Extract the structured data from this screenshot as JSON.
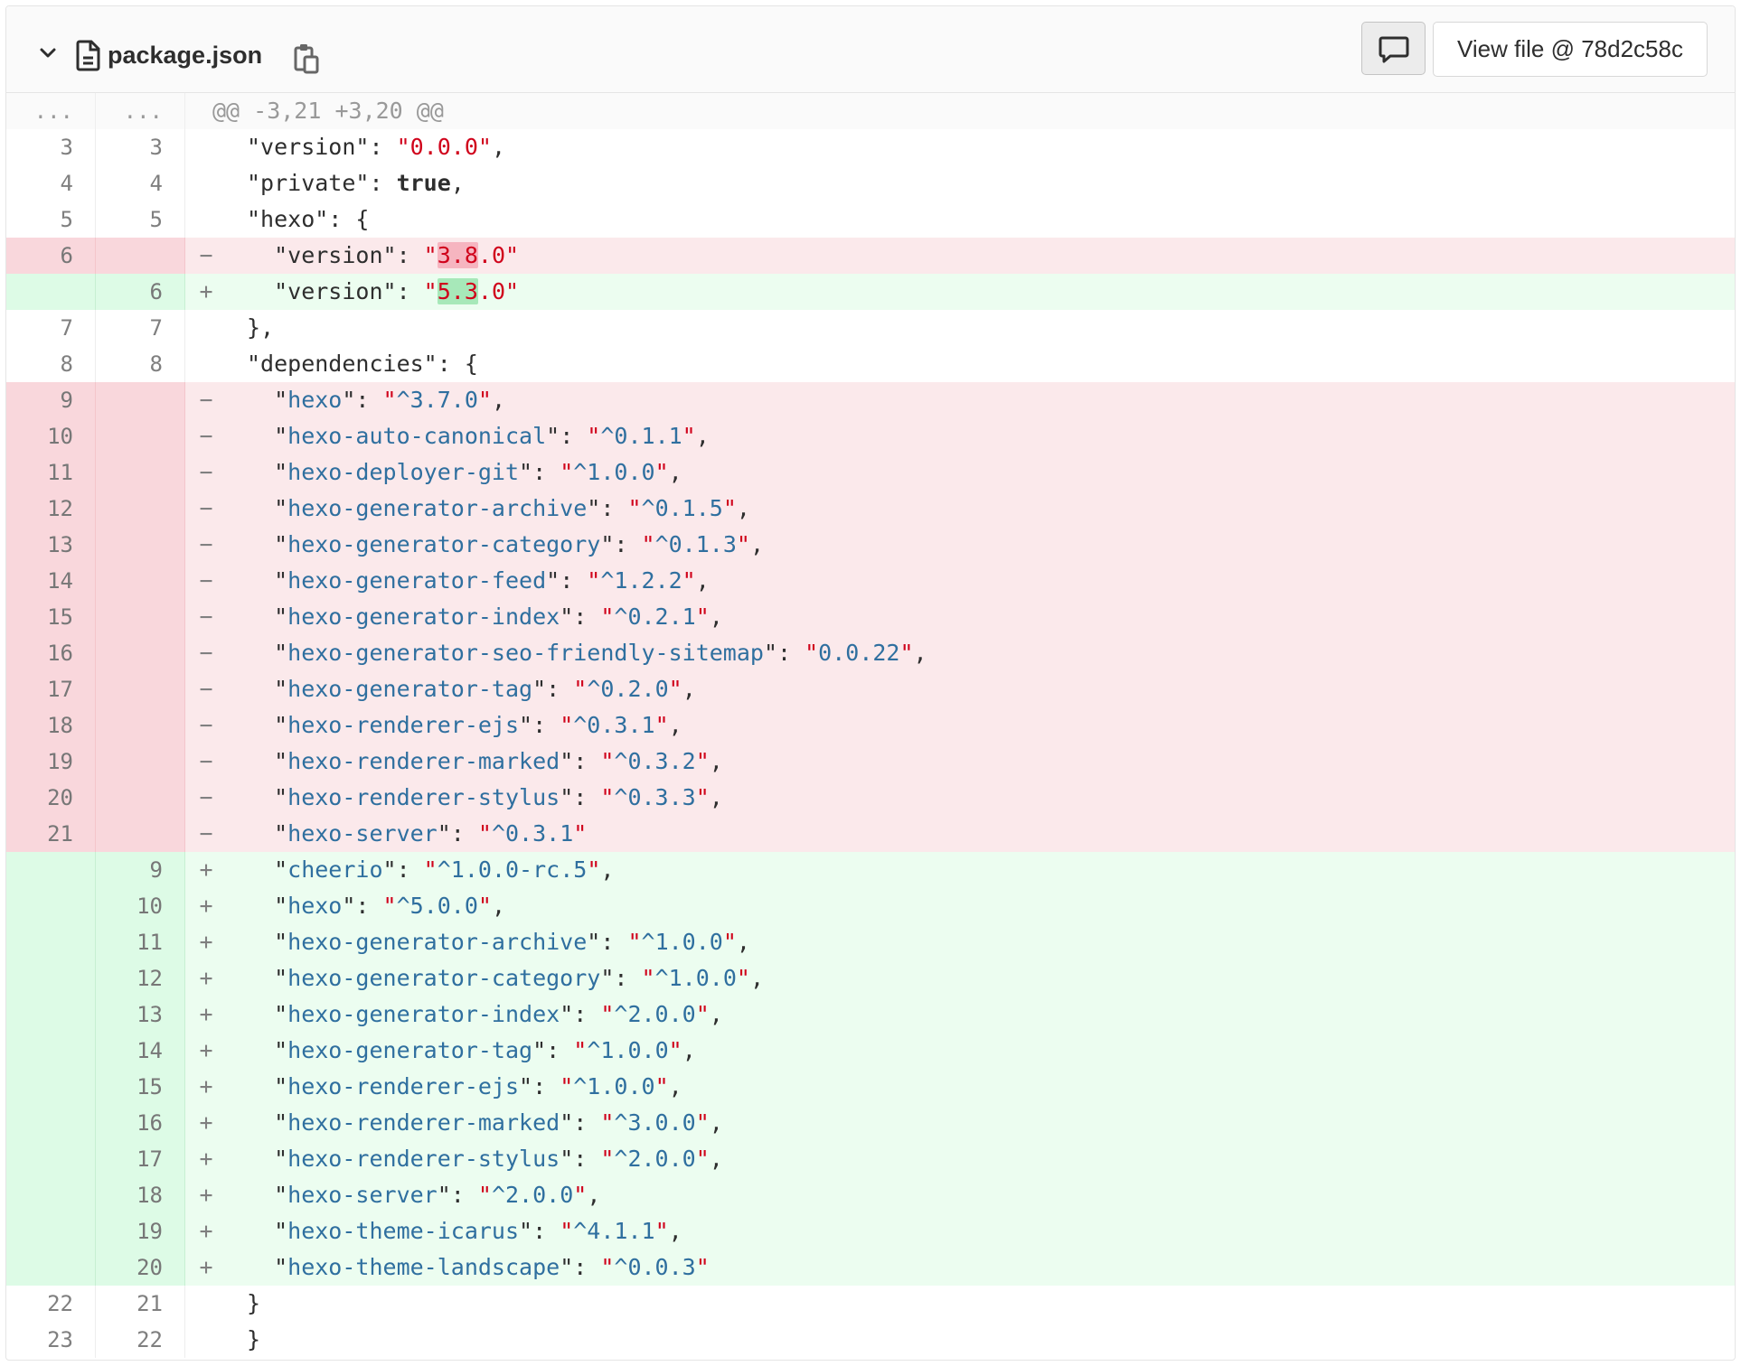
{
  "file": {
    "name": "package.json",
    "view_file_label": "View file @ 78d2c58c"
  },
  "icons": {
    "chevron": "chevron-down-icon",
    "file": "file-icon",
    "copy": "clipboard-icon",
    "comment": "comment-icon"
  },
  "colors": {
    "deleted_bg": "#fbe9eb",
    "added_bg": "#ecfdf0",
    "string": "#d0021b",
    "key": "#2f6f9f"
  },
  "diff": [
    {
      "type": "match",
      "old": "...",
      "new": "...",
      "sign": "",
      "seg": [
        {
          "t": "@@ -3,21 +3,20 @@",
          "c": ""
        }
      ]
    },
    {
      "type": "ctx",
      "old": "3",
      "new": "3",
      "sign": "",
      "seg": [
        {
          "t": "\"version\": ",
          "c": "punc"
        },
        {
          "t": "\"0.0.0\"",
          "c": "str"
        },
        {
          "t": ",",
          "c": "punc"
        }
      ]
    },
    {
      "type": "ctx",
      "old": "4",
      "new": "4",
      "sign": "",
      "seg": [
        {
          "t": "\"private\": ",
          "c": "punc"
        },
        {
          "t": "true",
          "c": "kw"
        },
        {
          "t": ",",
          "c": "punc"
        }
      ]
    },
    {
      "type": "ctx",
      "old": "5",
      "new": "5",
      "sign": "",
      "seg": [
        {
          "t": "\"hexo\": {",
          "c": "punc"
        }
      ]
    },
    {
      "type": "del",
      "old": "6",
      "new": "",
      "sign": "−",
      "seg": [
        {
          "t": "  \"version\": ",
          "c": "punc"
        },
        {
          "t": "\"",
          "c": "str"
        },
        {
          "t": "3.8",
          "c": "str hl-del"
        },
        {
          "t": ".0\"",
          "c": "str"
        }
      ]
    },
    {
      "type": "add",
      "old": "",
      "new": "6",
      "sign": "+",
      "seg": [
        {
          "t": "  \"version\": ",
          "c": "punc"
        },
        {
          "t": "\"",
          "c": "str"
        },
        {
          "t": "5.3",
          "c": "str hl-add"
        },
        {
          "t": ".0\"",
          "c": "str"
        }
      ]
    },
    {
      "type": "ctx",
      "old": "7",
      "new": "7",
      "sign": "",
      "seg": [
        {
          "t": "},",
          "c": "punc"
        }
      ]
    },
    {
      "type": "ctx",
      "old": "8",
      "new": "8",
      "sign": "",
      "seg": [
        {
          "t": "\"dependencies\": {",
          "c": "punc"
        }
      ]
    },
    {
      "type": "del",
      "old": "9",
      "new": "",
      "sign": "−",
      "seg": [
        {
          "t": "  \"",
          "c": "punc"
        },
        {
          "t": "hexo",
          "c": "key"
        },
        {
          "t": "\": ",
          "c": "punc"
        },
        {
          "t": "\"",
          "c": "str"
        },
        {
          "t": "^3.7.0",
          "c": "num"
        },
        {
          "t": "\"",
          "c": "str"
        },
        {
          "t": ",",
          "c": "punc"
        }
      ]
    },
    {
      "type": "del",
      "old": "10",
      "new": "",
      "sign": "−",
      "seg": [
        {
          "t": "  \"",
          "c": "punc"
        },
        {
          "t": "hexo-auto-canonical",
          "c": "key"
        },
        {
          "t": "\": ",
          "c": "punc"
        },
        {
          "t": "\"",
          "c": "str"
        },
        {
          "t": "^0.1.1",
          "c": "num"
        },
        {
          "t": "\"",
          "c": "str"
        },
        {
          "t": ",",
          "c": "punc"
        }
      ]
    },
    {
      "type": "del",
      "old": "11",
      "new": "",
      "sign": "−",
      "seg": [
        {
          "t": "  \"",
          "c": "punc"
        },
        {
          "t": "hexo-deployer-git",
          "c": "key"
        },
        {
          "t": "\": ",
          "c": "punc"
        },
        {
          "t": "\"",
          "c": "str"
        },
        {
          "t": "^1.0.0",
          "c": "num"
        },
        {
          "t": "\"",
          "c": "str"
        },
        {
          "t": ",",
          "c": "punc"
        }
      ]
    },
    {
      "type": "del",
      "old": "12",
      "new": "",
      "sign": "−",
      "seg": [
        {
          "t": "  \"",
          "c": "punc"
        },
        {
          "t": "hexo-generator-archive",
          "c": "key"
        },
        {
          "t": "\": ",
          "c": "punc"
        },
        {
          "t": "\"",
          "c": "str"
        },
        {
          "t": "^0.1.5",
          "c": "num"
        },
        {
          "t": "\"",
          "c": "str"
        },
        {
          "t": ",",
          "c": "punc"
        }
      ]
    },
    {
      "type": "del",
      "old": "13",
      "new": "",
      "sign": "−",
      "seg": [
        {
          "t": "  \"",
          "c": "punc"
        },
        {
          "t": "hexo-generator-category",
          "c": "key"
        },
        {
          "t": "\": ",
          "c": "punc"
        },
        {
          "t": "\"",
          "c": "str"
        },
        {
          "t": "^0.1.3",
          "c": "num"
        },
        {
          "t": "\"",
          "c": "str"
        },
        {
          "t": ",",
          "c": "punc"
        }
      ]
    },
    {
      "type": "del",
      "old": "14",
      "new": "",
      "sign": "−",
      "seg": [
        {
          "t": "  \"",
          "c": "punc"
        },
        {
          "t": "hexo-generator-feed",
          "c": "key"
        },
        {
          "t": "\": ",
          "c": "punc"
        },
        {
          "t": "\"",
          "c": "str"
        },
        {
          "t": "^1.2.2",
          "c": "num"
        },
        {
          "t": "\"",
          "c": "str"
        },
        {
          "t": ",",
          "c": "punc"
        }
      ]
    },
    {
      "type": "del",
      "old": "15",
      "new": "",
      "sign": "−",
      "seg": [
        {
          "t": "  \"",
          "c": "punc"
        },
        {
          "t": "hexo-generator-index",
          "c": "key"
        },
        {
          "t": "\": ",
          "c": "punc"
        },
        {
          "t": "\"",
          "c": "str"
        },
        {
          "t": "^0.2.1",
          "c": "num"
        },
        {
          "t": "\"",
          "c": "str"
        },
        {
          "t": ",",
          "c": "punc"
        }
      ]
    },
    {
      "type": "del",
      "old": "16",
      "new": "",
      "sign": "−",
      "seg": [
        {
          "t": "  \"",
          "c": "punc"
        },
        {
          "t": "hexo-generator-seo-friendly-sitemap",
          "c": "key"
        },
        {
          "t": "\": ",
          "c": "punc"
        },
        {
          "t": "\"",
          "c": "str"
        },
        {
          "t": "0.0.22",
          "c": "num"
        },
        {
          "t": "\"",
          "c": "str"
        },
        {
          "t": ",",
          "c": "punc"
        }
      ]
    },
    {
      "type": "del",
      "old": "17",
      "new": "",
      "sign": "−",
      "seg": [
        {
          "t": "  \"",
          "c": "punc"
        },
        {
          "t": "hexo-generator-tag",
          "c": "key"
        },
        {
          "t": "\": ",
          "c": "punc"
        },
        {
          "t": "\"",
          "c": "str"
        },
        {
          "t": "^0.2.0",
          "c": "num"
        },
        {
          "t": "\"",
          "c": "str"
        },
        {
          "t": ",",
          "c": "punc"
        }
      ]
    },
    {
      "type": "del",
      "old": "18",
      "new": "",
      "sign": "−",
      "seg": [
        {
          "t": "  \"",
          "c": "punc"
        },
        {
          "t": "hexo-renderer-ejs",
          "c": "key"
        },
        {
          "t": "\": ",
          "c": "punc"
        },
        {
          "t": "\"",
          "c": "str"
        },
        {
          "t": "^0.3.1",
          "c": "num"
        },
        {
          "t": "\"",
          "c": "str"
        },
        {
          "t": ",",
          "c": "punc"
        }
      ]
    },
    {
      "type": "del",
      "old": "19",
      "new": "",
      "sign": "−",
      "seg": [
        {
          "t": "  \"",
          "c": "punc"
        },
        {
          "t": "hexo-renderer-marked",
          "c": "key"
        },
        {
          "t": "\": ",
          "c": "punc"
        },
        {
          "t": "\"",
          "c": "str"
        },
        {
          "t": "^0.3.2",
          "c": "num"
        },
        {
          "t": "\"",
          "c": "str"
        },
        {
          "t": ",",
          "c": "punc"
        }
      ]
    },
    {
      "type": "del",
      "old": "20",
      "new": "",
      "sign": "−",
      "seg": [
        {
          "t": "  \"",
          "c": "punc"
        },
        {
          "t": "hexo-renderer-stylus",
          "c": "key"
        },
        {
          "t": "\": ",
          "c": "punc"
        },
        {
          "t": "\"",
          "c": "str"
        },
        {
          "t": "^0.3.3",
          "c": "num"
        },
        {
          "t": "\"",
          "c": "str"
        },
        {
          "t": ",",
          "c": "punc"
        }
      ]
    },
    {
      "type": "del",
      "old": "21",
      "new": "",
      "sign": "−",
      "seg": [
        {
          "t": "  \"",
          "c": "punc"
        },
        {
          "t": "hexo-server",
          "c": "key"
        },
        {
          "t": "\": ",
          "c": "punc"
        },
        {
          "t": "\"",
          "c": "str"
        },
        {
          "t": "^0.3.1",
          "c": "num"
        },
        {
          "t": "\"",
          "c": "str"
        }
      ]
    },
    {
      "type": "add",
      "old": "",
      "new": "9",
      "sign": "+",
      "seg": [
        {
          "t": "  \"",
          "c": "punc"
        },
        {
          "t": "cheerio",
          "c": "key"
        },
        {
          "t": "\": ",
          "c": "punc"
        },
        {
          "t": "\"",
          "c": "str"
        },
        {
          "t": "^1.0.0-rc.5",
          "c": "num"
        },
        {
          "t": "\"",
          "c": "str"
        },
        {
          "t": ",",
          "c": "punc"
        }
      ]
    },
    {
      "type": "add",
      "old": "",
      "new": "10",
      "sign": "+",
      "seg": [
        {
          "t": "  \"",
          "c": "punc"
        },
        {
          "t": "hexo",
          "c": "key"
        },
        {
          "t": "\": ",
          "c": "punc"
        },
        {
          "t": "\"",
          "c": "str"
        },
        {
          "t": "^5.0.0",
          "c": "num"
        },
        {
          "t": "\"",
          "c": "str"
        },
        {
          "t": ",",
          "c": "punc"
        }
      ]
    },
    {
      "type": "add",
      "old": "",
      "new": "11",
      "sign": "+",
      "seg": [
        {
          "t": "  \"",
          "c": "punc"
        },
        {
          "t": "hexo-generator-archive",
          "c": "key"
        },
        {
          "t": "\": ",
          "c": "punc"
        },
        {
          "t": "\"",
          "c": "str"
        },
        {
          "t": "^1.0.0",
          "c": "num"
        },
        {
          "t": "\"",
          "c": "str"
        },
        {
          "t": ",",
          "c": "punc"
        }
      ]
    },
    {
      "type": "add",
      "old": "",
      "new": "12",
      "sign": "+",
      "seg": [
        {
          "t": "  \"",
          "c": "punc"
        },
        {
          "t": "hexo-generator-category",
          "c": "key"
        },
        {
          "t": "\": ",
          "c": "punc"
        },
        {
          "t": "\"",
          "c": "str"
        },
        {
          "t": "^1.0.0",
          "c": "num"
        },
        {
          "t": "\"",
          "c": "str"
        },
        {
          "t": ",",
          "c": "punc"
        }
      ]
    },
    {
      "type": "add",
      "old": "",
      "new": "13",
      "sign": "+",
      "seg": [
        {
          "t": "  \"",
          "c": "punc"
        },
        {
          "t": "hexo-generator-index",
          "c": "key"
        },
        {
          "t": "\": ",
          "c": "punc"
        },
        {
          "t": "\"",
          "c": "str"
        },
        {
          "t": "^2.0.0",
          "c": "num"
        },
        {
          "t": "\"",
          "c": "str"
        },
        {
          "t": ",",
          "c": "punc"
        }
      ]
    },
    {
      "type": "add",
      "old": "",
      "new": "14",
      "sign": "+",
      "seg": [
        {
          "t": "  \"",
          "c": "punc"
        },
        {
          "t": "hexo-generator-tag",
          "c": "key"
        },
        {
          "t": "\": ",
          "c": "punc"
        },
        {
          "t": "\"",
          "c": "str"
        },
        {
          "t": "^1.0.0",
          "c": "num"
        },
        {
          "t": "\"",
          "c": "str"
        },
        {
          "t": ",",
          "c": "punc"
        }
      ]
    },
    {
      "type": "add",
      "old": "",
      "new": "15",
      "sign": "+",
      "seg": [
        {
          "t": "  \"",
          "c": "punc"
        },
        {
          "t": "hexo-renderer-ejs",
          "c": "key"
        },
        {
          "t": "\": ",
          "c": "punc"
        },
        {
          "t": "\"",
          "c": "str"
        },
        {
          "t": "^1.0.0",
          "c": "num"
        },
        {
          "t": "\"",
          "c": "str"
        },
        {
          "t": ",",
          "c": "punc"
        }
      ]
    },
    {
      "type": "add",
      "old": "",
      "new": "16",
      "sign": "+",
      "seg": [
        {
          "t": "  \"",
          "c": "punc"
        },
        {
          "t": "hexo-renderer-marked",
          "c": "key"
        },
        {
          "t": "\": ",
          "c": "punc"
        },
        {
          "t": "\"",
          "c": "str"
        },
        {
          "t": "^3.0.0",
          "c": "num"
        },
        {
          "t": "\"",
          "c": "str"
        },
        {
          "t": ",",
          "c": "punc"
        }
      ]
    },
    {
      "type": "add",
      "old": "",
      "new": "17",
      "sign": "+",
      "seg": [
        {
          "t": "  \"",
          "c": "punc"
        },
        {
          "t": "hexo-renderer-stylus",
          "c": "key"
        },
        {
          "t": "\": ",
          "c": "punc"
        },
        {
          "t": "\"",
          "c": "str"
        },
        {
          "t": "^2.0.0",
          "c": "num"
        },
        {
          "t": "\"",
          "c": "str"
        },
        {
          "t": ",",
          "c": "punc"
        }
      ]
    },
    {
      "type": "add",
      "old": "",
      "new": "18",
      "sign": "+",
      "seg": [
        {
          "t": "  \"",
          "c": "punc"
        },
        {
          "t": "hexo-server",
          "c": "key"
        },
        {
          "t": "\": ",
          "c": "punc"
        },
        {
          "t": "\"",
          "c": "str"
        },
        {
          "t": "^2.0.0",
          "c": "num"
        },
        {
          "t": "\"",
          "c": "str"
        },
        {
          "t": ",",
          "c": "punc"
        }
      ]
    },
    {
      "type": "add",
      "old": "",
      "new": "19",
      "sign": "+",
      "seg": [
        {
          "t": "  \"",
          "c": "punc"
        },
        {
          "t": "hexo-theme-icarus",
          "c": "key"
        },
        {
          "t": "\": ",
          "c": "punc"
        },
        {
          "t": "\"",
          "c": "str"
        },
        {
          "t": "^4.1.1",
          "c": "num"
        },
        {
          "t": "\"",
          "c": "str"
        },
        {
          "t": ",",
          "c": "punc"
        }
      ]
    },
    {
      "type": "add",
      "old": "",
      "new": "20",
      "sign": "+",
      "seg": [
        {
          "t": "  \"",
          "c": "punc"
        },
        {
          "t": "hexo-theme-landscape",
          "c": "key"
        },
        {
          "t": "\": ",
          "c": "punc"
        },
        {
          "t": "\"",
          "c": "str"
        },
        {
          "t": "^0.0.3",
          "c": "num"
        },
        {
          "t": "\"",
          "c": "str"
        }
      ]
    },
    {
      "type": "ctx",
      "old": "22",
      "new": "21",
      "sign": "",
      "seg": [
        {
          "t": "}",
          "c": "punc"
        }
      ]
    },
    {
      "type": "ctx",
      "old": "23",
      "new": "22",
      "sign": "",
      "seg": [
        {
          "t": "}",
          "c": "punc"
        }
      ]
    }
  ]
}
